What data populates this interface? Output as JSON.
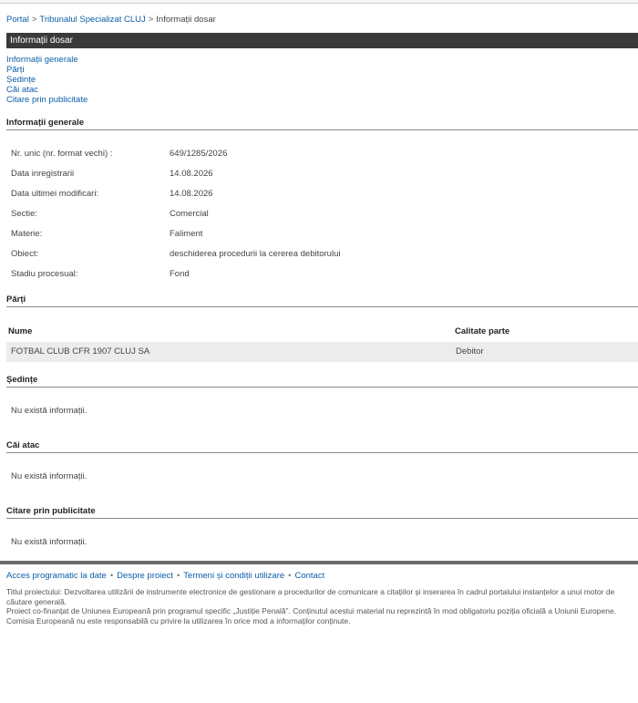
{
  "breadcrumb": {
    "portal": "Portal",
    "sep1": ">",
    "court": "Tribunalul Specializat CLUJ",
    "sep2": ">",
    "current": "Informații dosar"
  },
  "title_bar": "Informații dosar",
  "anchors": [
    "Informații generale",
    "Părți",
    "Ședințe",
    "Căi atac",
    "Citare prin publicitate"
  ],
  "general": {
    "heading": "Informații generale",
    "rows": [
      {
        "label": "Nr. unic (nr. format vechi) :",
        "value": "649/1285/2026"
      },
      {
        "label": "Data inregistrarii",
        "value": "14.08.2026"
      },
      {
        "label": "Data ultimei modificari:",
        "value": "14.08.2026"
      },
      {
        "label": "Sectie:",
        "value": "Comercial"
      },
      {
        "label": "Materie:",
        "value": "Faliment"
      },
      {
        "label": "Obiect:",
        "value": "deschiderea procedurii la cererea debitorului"
      },
      {
        "label": "Stadiu procesual:",
        "value": "Fond"
      }
    ]
  },
  "parti": {
    "heading": "Părți",
    "col_name": "Nume",
    "col_role": "Calitate parte",
    "rows": [
      {
        "name": "FOTBAL CLUB CFR 1907 CLUJ SA",
        "role": "Debitor"
      }
    ]
  },
  "sedinte": {
    "heading": "Ședințe",
    "empty": "Nu există informații."
  },
  "cai_atac": {
    "heading": "Căi atac",
    "empty": "Nu există informații."
  },
  "citare": {
    "heading": "Citare prin publicitate",
    "empty": "Nu există informații."
  },
  "footer": {
    "links": [
      "Acces programatic la date",
      "Despre proiect",
      "Termeni și condiții utilizare",
      "Contact"
    ],
    "dot": "•",
    "text1": "Titlul proiectului: Dezvoltarea utilizării de instrumente electronice de gestionare a procedurilor de comunicare a citațiilor și inserarea în cadrul portalului instanțelor a unui motor de căutare generală.",
    "text2": "Proiect co-finanțat de Uniunea Europeană prin programul specific „Justiție Penală”. Conținutul acestui material nu reprezintă în mod obligatoriu poziția oficială a Uniunii Europene. Comisia Europeană nu este responsabilă cu privire la utilizarea în orice mod a informaților conținute."
  }
}
